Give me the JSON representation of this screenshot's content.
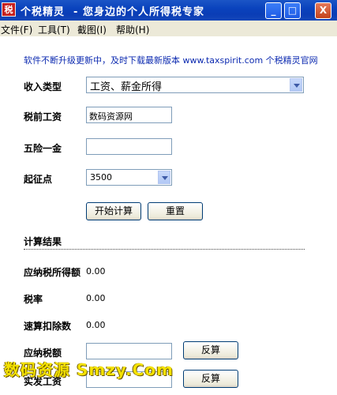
{
  "window": {
    "app_icon_text": "税",
    "title": "个税精灵  - 您身边的个人所得税专家",
    "buttons": {
      "minimize": "_",
      "maximize": "□",
      "close": "X"
    }
  },
  "menu": [
    "文件(F)",
    "工具(T)",
    "截图(I)",
    "帮助(H)"
  ],
  "notice": "软件不断升级更新中，及时下载最新版本 www.taxspirit.com 个税精灵官网",
  "form": {
    "income_type": {
      "label": "收入类型",
      "value": "工资、薪金所得"
    },
    "pre_tax_salary": {
      "label": "税前工资",
      "value": "数码资源网"
    },
    "insurance": {
      "label": "五险一金",
      "value": ""
    },
    "threshold": {
      "label": "起征点",
      "value": "3500"
    }
  },
  "actions": {
    "calculate": "开始计算",
    "reset": "重置"
  },
  "results": {
    "title": "计算结果",
    "taxable_income": {
      "label": "应纳税所得额",
      "value": "0.00"
    },
    "tax_rate": {
      "label": "税率",
      "value": "0.00"
    },
    "quick_deduction": {
      "label": "速算扣除数",
      "value": "0.00"
    },
    "tax_payable": {
      "label": "应纳税额",
      "value": "",
      "button": "反算"
    },
    "net_salary": {
      "label": "实发工资",
      "value": "",
      "button": "反算"
    }
  },
  "watermark": "数码资源 Smzy.Com"
}
